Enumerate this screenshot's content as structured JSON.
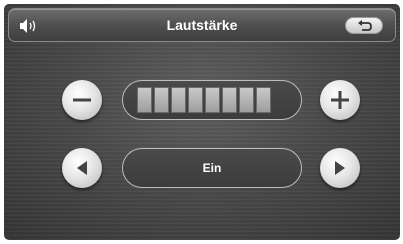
{
  "header": {
    "title": "Lautstärke",
    "left_icon": "speaker-icon",
    "right_icon": "back-arrow-icon"
  },
  "volume": {
    "level_segments": 8,
    "decrease_icon": "minus-icon",
    "increase_icon": "plus-icon"
  },
  "mode": {
    "value": "Ein",
    "prev_icon": "triangle-left-icon",
    "next_icon": "triangle-right-icon"
  },
  "colors": {
    "background": "#4a4a4a",
    "titlebar": "#5a5a5a",
    "text": "#ffffff",
    "button": "#e6e6e6",
    "segment": "#b5b5b5"
  }
}
